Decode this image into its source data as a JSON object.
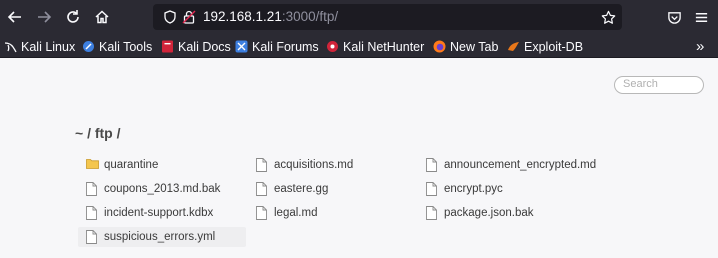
{
  "browser": {
    "url_host": "192.168.1.21",
    "url_path": ":3000/ftp/"
  },
  "bookmarks": [
    {
      "label": "Kali Linux",
      "icon": "kali-dragon-icon"
    },
    {
      "label": "Kali Tools",
      "icon": "kali-tools-icon"
    },
    {
      "label": "Kali Docs",
      "icon": "kali-docs-icon"
    },
    {
      "label": "Kali Forums",
      "icon": "kali-forums-icon"
    },
    {
      "label": "Kali NetHunter",
      "icon": "kali-nethunter-icon"
    },
    {
      "label": "New Tab",
      "icon": "firefox-icon"
    },
    {
      "label": "Exploit-DB",
      "icon": "exploit-db-icon"
    }
  ],
  "page": {
    "search_placeholder": "Search",
    "heading": "~ / ftp /",
    "files": [
      {
        "name": "quarantine",
        "type": "folder"
      },
      {
        "name": "acquisitions.md",
        "type": "file"
      },
      {
        "name": "announcement_encrypted.md",
        "type": "file"
      },
      {
        "name": "coupons_2013.md.bak",
        "type": "file"
      },
      {
        "name": "eastere.gg",
        "type": "file"
      },
      {
        "name": "encrypt.pyc",
        "type": "file"
      },
      {
        "name": "incident-support.kdbx",
        "type": "file"
      },
      {
        "name": "legal.md",
        "type": "file"
      },
      {
        "name": "package.json.bak",
        "type": "file"
      },
      {
        "name": "suspicious_errors.yml",
        "type": "file"
      }
    ]
  }
}
